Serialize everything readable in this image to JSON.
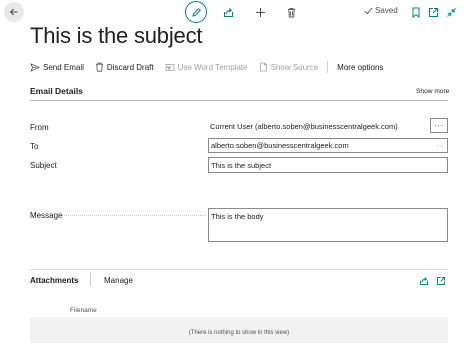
{
  "title": "This is the subject",
  "status": {
    "saved": "Saved"
  },
  "actions": {
    "send_email": "Send Email",
    "discard_draft": "Discard Draft",
    "use_word_template": "Use Word Template",
    "show_source": "Show Source",
    "more_options": "More options"
  },
  "section": {
    "title": "Email Details",
    "show_more": "Show more"
  },
  "fields": {
    "from_label": "From",
    "from_value": "Current User (alberto.soben@businesscentralgeek.com)",
    "to_label": "To",
    "to_value": "alberto.soben@businesscentralgeek.com",
    "subject_label": "Subject",
    "subject_value": "This is the subject",
    "message_label": "Message",
    "message_value": "This is the body",
    "lookup_dots": "···",
    "to_dots": "···"
  },
  "attachments": {
    "title": "Attachments",
    "manage": "Manage",
    "column_filename": "Filename",
    "empty_text": "(There is nothing to show in this view)"
  },
  "colors": {
    "accent": "#00807f",
    "border": "#8a8a8a",
    "text": "#212121"
  }
}
